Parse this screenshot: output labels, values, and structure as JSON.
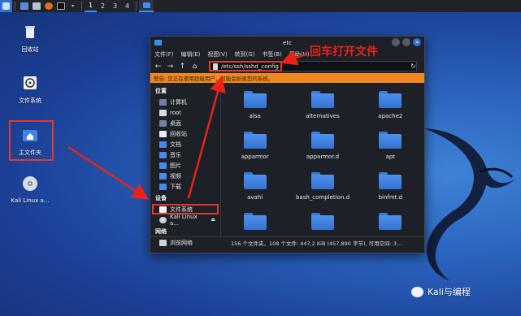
{
  "panel": {
    "workspaces": [
      "1",
      "2",
      "3",
      "4"
    ]
  },
  "desktop": {
    "icons": [
      {
        "label": "回收站",
        "icon": "trash-icon"
      },
      {
        "label": "文件系统",
        "icon": "drive-icon"
      },
      {
        "label": "主文件夹",
        "icon": "home-folder-icon"
      },
      {
        "label": "Kali Linux a...",
        "icon": "disc-icon"
      }
    ]
  },
  "window": {
    "title": "etc",
    "menu": [
      "文件(F)",
      "编辑(E)",
      "视图(V)",
      "转到(G)",
      "书签(B)",
      "帮助(H)"
    ],
    "nav": {
      "back": "←",
      "forward": "→",
      "up": "↑",
      "home": "⌂",
      "reload": "↻"
    },
    "address": "/etc/ssh/sshd_config",
    "warning": "警告: 您正在使用超级用户，可能会损害您的系统。",
    "sidebar": {
      "places_header": "位置",
      "places": [
        "计算机",
        "root",
        "桌面",
        "回收站",
        "文档",
        "音乐",
        "图片",
        "视频",
        "下载"
      ],
      "devices_header": "设备",
      "devices": [
        "文件系统",
        "Kali Linux a..."
      ],
      "network_header": "网络",
      "network": [
        "浏览网络"
      ]
    },
    "folders": [
      "alsa",
      "alternatives",
      "apache2",
      "apparmor",
      "apparmor.d",
      "apt",
      "avahi",
      "bash_completion.d",
      "binfmt.d",
      "",
      "",
      ""
    ],
    "status": "156 个文件夹，108 个文件: 447.2 KiB (457,890 字节), 可用空间: 3..."
  },
  "annotation": {
    "text": "回车打开文件",
    "color": "#e8231a"
  },
  "watermark": {
    "text": "Kali与编程"
  }
}
